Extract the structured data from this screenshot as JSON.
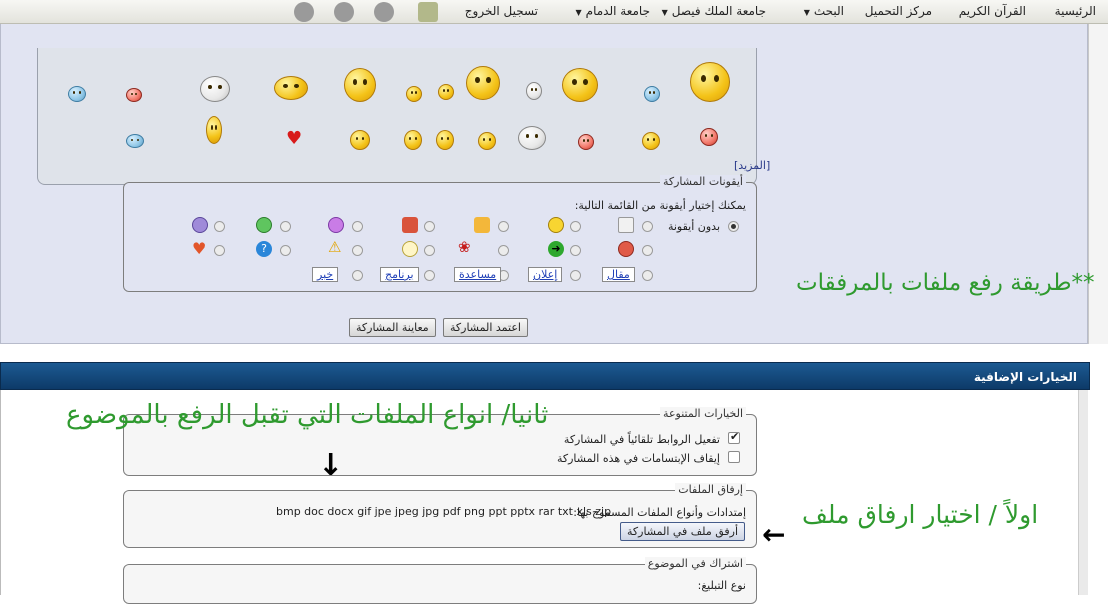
{
  "topnav": {
    "items": [
      "الرئيسية",
      "القرآن الكريم",
      "مركز التحميل",
      "البحث",
      "جامعة الملك فيصل",
      "جامعة الدمام",
      "تسجيل الخروج"
    ],
    "icon_names": [
      "book-icon",
      "globe-icon",
      "avatar-icon",
      "heart-icon"
    ]
  },
  "smilies": {
    "more_link": "[المزيد]"
  },
  "post_icons": {
    "legend": "أيقونات المشاركة",
    "instruction": "يمكنك إختيار أيقونة من القائمة التالية:",
    "no_icon_label": "بدون أيقونة",
    "word_buttons": [
      "مقال",
      "إعلان",
      "مساعدة",
      "برنامج",
      "خبر"
    ]
  },
  "submit": {
    "submit_label": "اعتمد المشاركة",
    "preview_label": "معاينة المشاركة"
  },
  "annotations": {
    "upload_method": "**طريقة رفع ملفات بالمرفقات",
    "file_types": "ثانيا/ انواع الملفات التي تقبل الرفع بالموضوع",
    "step_one": "اولاً / اختيار ارفاق ملف"
  },
  "additional_options": {
    "header": "الخيارات الإضافية",
    "misc": {
      "legend": "الخيارات المتنوعة",
      "auto_links": "تفعيل الروابط تلقائياً في المشاركة",
      "disable_smilies": "إيقاف الإبتسامات في هذه المشاركة",
      "auto_links_checked": true,
      "disable_smilies_checked": false
    },
    "attachments": {
      "legend": "إرفاق الملفات",
      "allowed_label": "إمتدادات وأنواع الملفات المسموح بها:",
      "extensions": "bmp doc docx gif jpe jpeg jpg pdf png ppt pptx rar txt xls zip",
      "attach_button": "أرفق ملف في المشاركة"
    },
    "subscribe": {
      "legend": "اشتراك في الموضوع",
      "notify_type_label": "نوع التبليغ:"
    }
  },
  "colors": {
    "annotation_green": "#2f9a2f",
    "header_blue": "#0d3a68",
    "panel_lavender": "#e1e4f2"
  }
}
